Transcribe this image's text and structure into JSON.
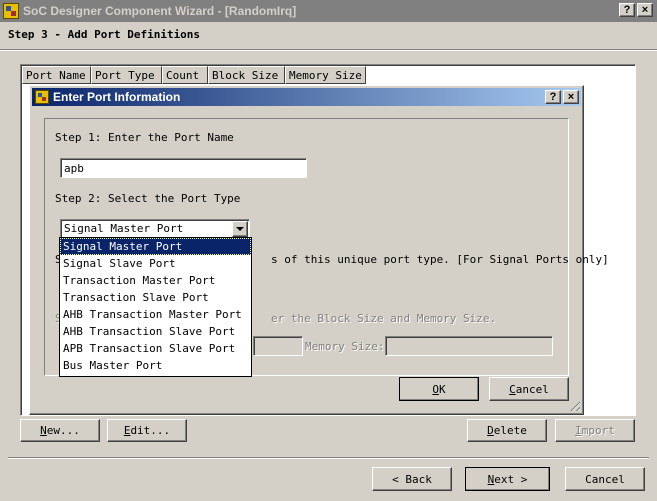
{
  "window": {
    "title": "SoC Designer Component Wizard - [RandomIrq]",
    "help_btn": "?",
    "close_btn": "×"
  },
  "step_header": "Step 3 - Add Port Definitions",
  "list": {
    "columns": [
      "Port Name",
      "Port Type",
      "Count",
      "Block Size",
      "Memory Size"
    ]
  },
  "buttons": {
    "new": "New...",
    "edit": "Edit...",
    "delete": "Delete",
    "import": "Import",
    "back": "< Back",
    "next": "Next >",
    "cancel": "Cancel"
  },
  "dialog": {
    "title": "Enter Port Information",
    "help_btn": "?",
    "close_btn": "×",
    "step1_label": "Step 1:  Enter the Port Name",
    "port_name_value": "apb",
    "step2_label": "Step 2:  Select the Port Type",
    "port_type_selected": "Signal Master Port",
    "step3_label_prefix": "S",
    "step3_label_rest": "s of this unique port type. [For Signal Ports only]",
    "step4_label_prefix": "S",
    "step4_label_rest": "er the Block Size and Memory Size.",
    "memory_size_label": "Memory Size:",
    "ok": "OK",
    "cancel": "Cancel"
  },
  "dropdown": {
    "options": [
      "Signal Master Port",
      "Signal Slave Port",
      "Transaction Master Port",
      "Transaction Slave Port",
      "AHB Transaction Master Port",
      "AHB Transaction Slave Port",
      "APB Transaction Slave Port",
      "Bus Master Port"
    ],
    "selected_index": 0
  }
}
